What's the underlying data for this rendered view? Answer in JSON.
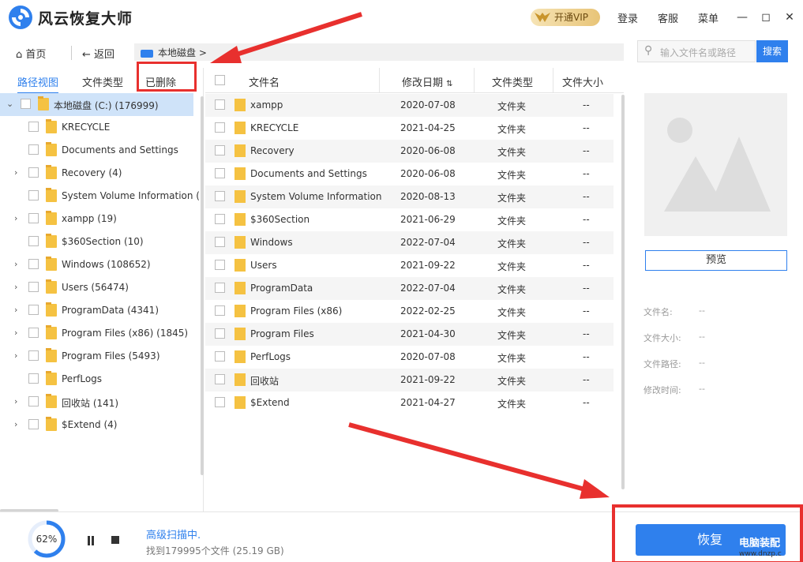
{
  "app": {
    "title": "风云恢复大师"
  },
  "header": {
    "vip": "开通VIP",
    "login": "登录",
    "service": "客服",
    "menu": "菜单"
  },
  "nav": {
    "home": "首页",
    "back": "返回",
    "breadcrumb": "本地磁盘 >",
    "search_placeholder": "输入文件名或路径",
    "search_button": "搜索"
  },
  "left_tabs": [
    "路径视图",
    "文件类型",
    "已删除"
  ],
  "tree": [
    {
      "label": "本地磁盘 (C:) (176999)"
    },
    {
      "label": "KRECYCLE"
    },
    {
      "label": "Documents and Settings"
    },
    {
      "label": "Recovery (4)"
    },
    {
      "label": "System Volume Information ("
    },
    {
      "label": "xampp (19)"
    },
    {
      "label": "$360Section (10)"
    },
    {
      "label": "Windows (108652)"
    },
    {
      "label": "Users (56474)"
    },
    {
      "label": "ProgramData (4341)"
    },
    {
      "label": "Program Files (x86) (1845)"
    },
    {
      "label": "Program Files (5493)"
    },
    {
      "label": "PerfLogs"
    },
    {
      "label": "回收站 (141)"
    },
    {
      "label": "$Extend (4)"
    }
  ],
  "columns": {
    "name": "文件名",
    "date": "修改日期",
    "type": "文件类型",
    "size": "文件大小"
  },
  "files": [
    {
      "name": "xampp",
      "date": "2020-07-08",
      "type": "文件夹",
      "size": "--"
    },
    {
      "name": "KRECYCLE",
      "date": "2021-04-25",
      "type": "文件夹",
      "size": "--"
    },
    {
      "name": "Recovery",
      "date": "2020-06-08",
      "type": "文件夹",
      "size": "--"
    },
    {
      "name": "Documents and Settings",
      "date": "2020-06-08",
      "type": "文件夹",
      "size": "--"
    },
    {
      "name": "System Volume Information",
      "date": "2020-08-13",
      "type": "文件夹",
      "size": "--"
    },
    {
      "name": "$360Section",
      "date": "2021-06-29",
      "type": "文件夹",
      "size": "--"
    },
    {
      "name": "Windows",
      "date": "2022-07-04",
      "type": "文件夹",
      "size": "--"
    },
    {
      "name": "Users",
      "date": "2021-09-22",
      "type": "文件夹",
      "size": "--"
    },
    {
      "name": "ProgramData",
      "date": "2022-07-04",
      "type": "文件夹",
      "size": "--"
    },
    {
      "name": "Program Files (x86)",
      "date": "2022-02-25",
      "type": "文件夹",
      "size": "--"
    },
    {
      "name": "Program Files",
      "date": "2021-04-30",
      "type": "文件夹",
      "size": "--"
    },
    {
      "name": "PerfLogs",
      "date": "2020-07-08",
      "type": "文件夹",
      "size": "--"
    },
    {
      "name": "回收站",
      "date": "2021-09-22",
      "type": "文件夹",
      "size": "--"
    },
    {
      "name": "$Extend",
      "date": "2021-04-27",
      "type": "文件夹",
      "size": "--"
    }
  ],
  "details": {
    "preview_button": "预览",
    "file_name_label": "文件名:",
    "file_size_label": "文件大小:",
    "file_path_label": "文件路径:",
    "modified_label": "修改时间:",
    "empty_value": "--"
  },
  "status": {
    "progress": 0.62,
    "progress_text": "62%",
    "scanning": "高级扫描中.",
    "found": "找到179995个文件 (25.19 GB)",
    "recover_button": "恢复"
  },
  "watermark": {
    "text": "电脑装配",
    "url": "www.dnzp.c"
  },
  "colors": {
    "accent": "#2f80ed",
    "highlight": "#e8302e",
    "folder": "#f5c242"
  }
}
